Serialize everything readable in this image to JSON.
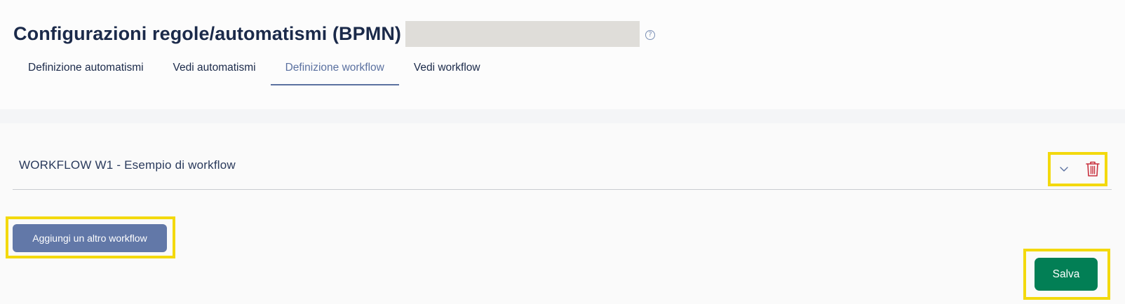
{
  "page": {
    "title": "Configurazioni regole/automatismi (BPMN)",
    "help_glyph": "?"
  },
  "tabs": [
    {
      "label": "Definizione automatismi",
      "active": false
    },
    {
      "label": "Vedi automatismi",
      "active": false
    },
    {
      "label": "Definizione workflow",
      "active": true
    },
    {
      "label": "Vedi workflow",
      "active": false
    }
  ],
  "workflow": {
    "title": "WORKFLOW W1 - Esempio di workflow",
    "expand_icon": "chevron-down-icon",
    "delete_icon": "trash-icon"
  },
  "actions": {
    "add_label": "Aggiungi un altro workflow",
    "save_label": "Salva"
  },
  "colors": {
    "accent": "#5b71a0",
    "add_button": "#6278a8",
    "save_button": "#027f55",
    "delete_icon": "#c8303d",
    "highlight": "#f3d90d",
    "redaction": "#dfddd9"
  }
}
